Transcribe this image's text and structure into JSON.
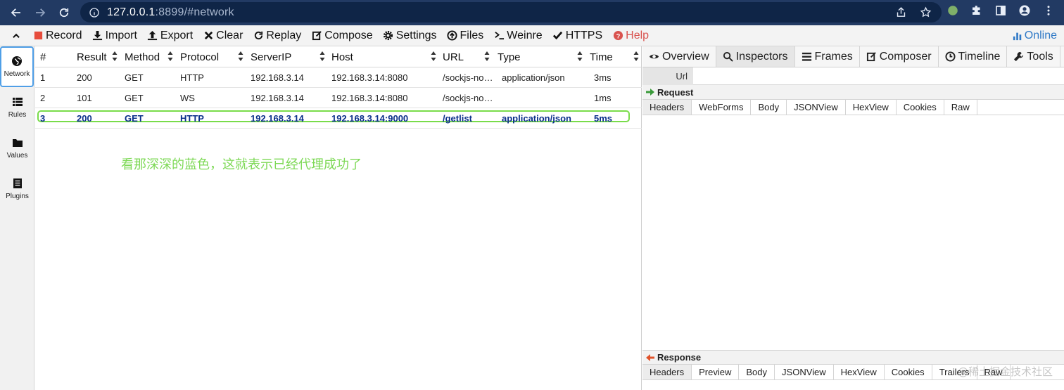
{
  "browser": {
    "address_host": "127.0.0.1",
    "address_rest": ":8899/#network"
  },
  "toolbar": {
    "record": "Record",
    "import": "Import",
    "export": "Export",
    "clear": "Clear",
    "replay": "Replay",
    "compose": "Compose",
    "settings": "Settings",
    "files": "Files",
    "weinre": "Weinre",
    "https": "HTTPS",
    "help": "Help",
    "online": "Online",
    "record_color": "#e74c3c",
    "help_color": "#d9534f",
    "online_color": "#2f79c6"
  },
  "sidebar": {
    "items": [
      {
        "label": "Network",
        "icon": "globe-icon",
        "active": true
      },
      {
        "label": "Rules",
        "icon": "list-icon",
        "active": false
      },
      {
        "label": "Values",
        "icon": "folder-icon",
        "active": false
      },
      {
        "label": "Plugins",
        "icon": "document-icon",
        "active": false
      }
    ]
  },
  "grid": {
    "headers": [
      "#",
      "Result",
      "Method",
      "Protocol",
      "ServerIP",
      "Host",
      "URL",
      "Type",
      "Time"
    ],
    "rows": [
      {
        "num": "1",
        "result": "200",
        "method": "GET",
        "protocol": "HTTP",
        "serverip": "192.168.3.14",
        "host": "192.168.3.14:8080",
        "url": "/sockjs-no…",
        "type": "application/json",
        "time": "3ms"
      },
      {
        "num": "2",
        "result": "101",
        "method": "GET",
        "protocol": "WS",
        "serverip": "192.168.3.14",
        "host": "192.168.3.14:8080",
        "url": "/sockjs-no…",
        "type": "",
        "time": "1ms"
      },
      {
        "num": "3",
        "result": "200",
        "method": "GET",
        "protocol": "HTTP",
        "serverip": "192.168.3.14",
        "host": "192.168.3.14:9000",
        "url": "/getlist",
        "type": "application/json",
        "time": "5ms"
      }
    ],
    "selected_row_color": "#0a2f8a",
    "highlight_color": "#79dc4a"
  },
  "annotation": "看那深深的蓝色，这就表示已经代理成功了",
  "right": {
    "tabs": [
      "Overview",
      "Inspectors",
      "Frames",
      "Composer",
      "Timeline",
      "Tools"
    ],
    "url_label": "Url",
    "request_title": "Request",
    "request_tabs": [
      "Headers",
      "WebForms",
      "Body",
      "JSONView",
      "HexView",
      "Cookies",
      "Raw"
    ],
    "response_title": "Response",
    "response_tabs": [
      "Headers",
      "Preview",
      "Body",
      "JSONView",
      "HexView",
      "Cookies",
      "Trailers",
      "Raw"
    ],
    "request_arrow_color": "#3a9a3a",
    "response_arrow_color": "#e0522a"
  },
  "watermark": "@稀土掘金技术社区"
}
